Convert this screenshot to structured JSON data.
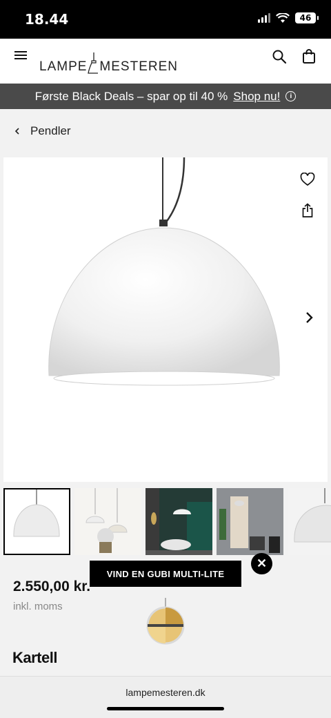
{
  "status_bar": {
    "time": "18.44",
    "battery": "46"
  },
  "header": {
    "logo_left": "LAMPE",
    "logo_right": "MESTEREN"
  },
  "promo_bar": {
    "text": "Første Black Deals – spar op til 40 %",
    "link": "Shop nu!"
  },
  "breadcrumb": {
    "label": "Pendler"
  },
  "product": {
    "price": "2.550,00 kr.",
    "vat_note": "inkl. moms",
    "brand": "Kartell",
    "image_count": 5,
    "active_image": 1
  },
  "overlay": {
    "banner_label": "VIND EN GUBI MULTI-LITE"
  },
  "browser": {
    "url": "lampemesteren.dk"
  },
  "icons": [
    "menu-icon",
    "search-icon",
    "cart-icon",
    "info-icon",
    "chevron-left-icon",
    "heart-icon",
    "share-icon",
    "chevron-right-icon",
    "close-icon"
  ]
}
